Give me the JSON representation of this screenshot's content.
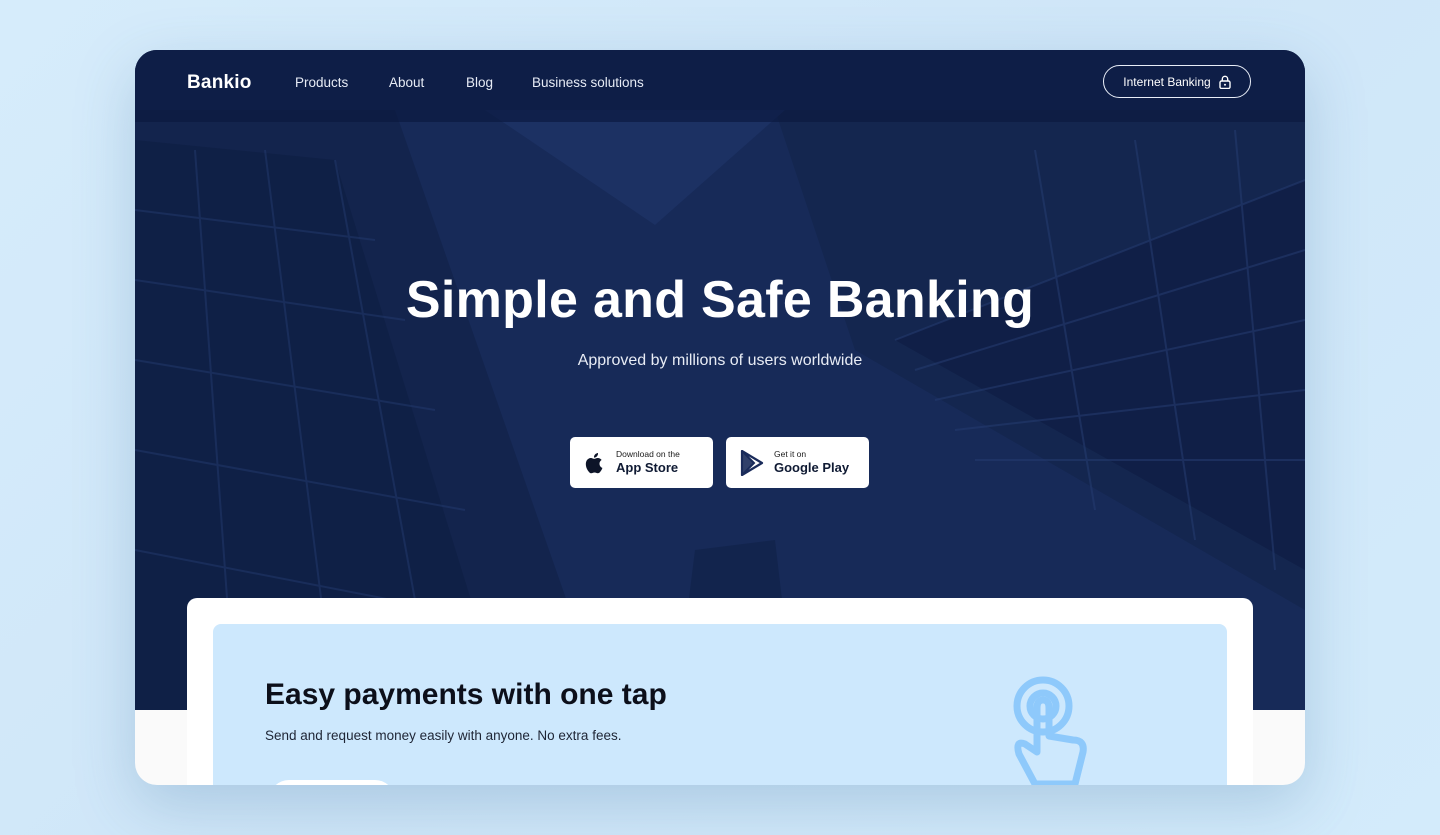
{
  "nav": {
    "logo": "Bankio",
    "links": [
      "Products",
      "About",
      "Blog",
      "Business solutions"
    ],
    "internet_banking": "Internet Banking"
  },
  "hero": {
    "title": "Simple and Safe Banking",
    "subtitle": "Approved by millions of users worldwide",
    "app_store": {
      "small": "Download on the",
      "big": "App Store"
    },
    "google_play": {
      "small": "Get it on",
      "big": "Google Play"
    }
  },
  "feature": {
    "title": "Easy payments with one tap",
    "subtitle": "Send and request money easily with anyone. No extra fees."
  },
  "colors": {
    "hero_bg": "#172a58",
    "accent_light": "#cde8fd",
    "icon_blue": "#8ec9fb"
  }
}
